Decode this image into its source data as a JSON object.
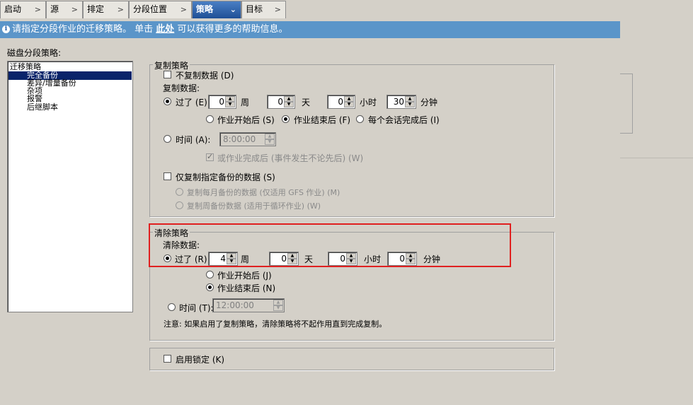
{
  "tabs": [
    {
      "label": "启动"
    },
    {
      "label": "源"
    },
    {
      "label": "排定"
    },
    {
      "label": "分段位置"
    },
    {
      "label": "策略"
    },
    {
      "label": "目标"
    }
  ],
  "info": {
    "text_before": "请指定分段作业的迁移策略。 单击",
    "link": "此处",
    "text_after": "可以获得更多的帮助信息。"
  },
  "left_panel": {
    "title": "磁盘分段策略:",
    "tree": [
      "迁移策略",
      "完全备份",
      "差异/增量备份",
      "杂项",
      "报警",
      "后继脚本"
    ]
  },
  "copy_policy": {
    "legend": "复制策略",
    "no_copy": "不复制数据 (D)",
    "copy_data": "复制数据:",
    "after": "过了 (E)",
    "week_value": "0",
    "week_unit": "周",
    "day_value": "0",
    "day_unit": "天",
    "hour_value": "0",
    "hour_unit": "小时",
    "minute_value": "30",
    "minute_unit": "分钟",
    "opt_job_start": "作业开始后 (S)",
    "opt_job_end": "作业结束后 (F)",
    "opt_each_session": "每个会话完成后 (I)",
    "time": "时间 (A):",
    "time_value": "8:00:00",
    "or_job_done": "或作业完成后 (事件发生不论先后) (W)",
    "only_specified": "仅复制指定备份的数据 (S)",
    "copy_monthly": "复制每月备份的数据 (仅适用 GFS 作业) (M)",
    "copy_weekly": "复制周备份数据 (适用于循环作业) (W)"
  },
  "purge_policy": {
    "legend": "清除策略",
    "purge_data": "清除数据:",
    "after": "过了 (R)",
    "week_value": "4",
    "week_unit": "周",
    "day_value": "0",
    "day_unit": "天",
    "hour_value": "0",
    "hour_unit": "小时",
    "minute_value": "0",
    "minute_unit": "分钟",
    "opt_job_start": "作业开始后 (J)",
    "opt_job_end": "作业结束后 (N)",
    "time": "时间 (T):",
    "time_value": "12:00:00",
    "note": "注意: 如果启用了复制策略，清除策略将不起作用直到完成复制。"
  },
  "lock": {
    "label": "启用锁定 (K)"
  },
  "colors": {
    "info_bar": "#5b95c9",
    "active_tab": "#1e4f96",
    "highlight": "#e02020",
    "selection": "#0a246a"
  }
}
